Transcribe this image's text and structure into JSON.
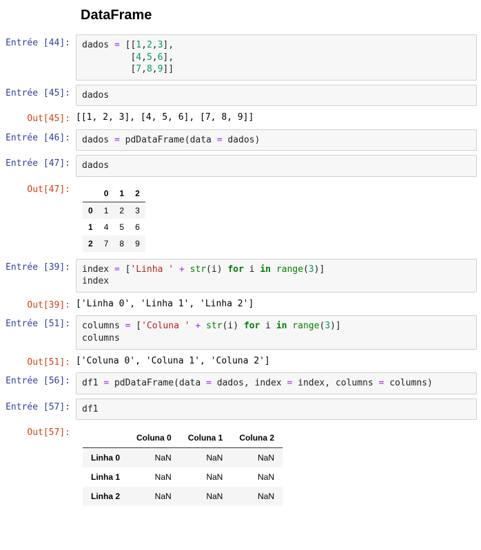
{
  "title": "DataFrame",
  "cells": {
    "c44": {
      "in_label": "Entrée [44]:"
    },
    "c45": {
      "in_label": "Entrée [45]:",
      "out_label": "Out[45]:",
      "out_text": "[[1, 2, 3], [4, 5, 6], [7, 8, 9]]"
    },
    "c46": {
      "in_label": "Entrée [46]:"
    },
    "c47": {
      "in_label": "Entrée [47]:",
      "out_label": "Out[47]:"
    },
    "c39": {
      "in_label": "Entrée [39]:",
      "out_label": "Out[39]:",
      "out_text": "['Linha 0', 'Linha 1', 'Linha 2']"
    },
    "c51": {
      "in_label": "Entrée [51]:",
      "out_label": "Out[51]:",
      "out_text": "['Coluna 0', 'Coluna 1', 'Coluna 2']"
    },
    "c56": {
      "in_label": "Entrée [56]:"
    },
    "c57": {
      "in_label": "Entrée [57]:",
      "out_label": "Out[57]:"
    }
  },
  "code": {
    "c44": {
      "plain": "dados = [[1,2,3],\n         [4,5,6],\n         [7,8,9]]",
      "t": {
        "dados": "dados",
        "eq": "=",
        "o1": "[[",
        "n1": "1",
        "c": ",",
        "n2": "2",
        "n3": "3",
        "cb": "],",
        "sp": "         ",
        "ob": "[",
        "n4": "4",
        "n5": "5",
        "n6": "6",
        "n7": "7",
        "n8": "8",
        "n9": "9",
        "cc": "]]"
      }
    },
    "c45": {
      "t": {
        "dados": "dados"
      }
    },
    "c46": {
      "plain": "dados = pd.DataFrame(data = dados)",
      "t": {
        "dados": "dados",
        "eq": "=",
        "pd": "pd",
        ".": ".",
        "DF": "DataFrame",
        "op": "(",
        "data": "data",
        "eq2": "=",
        "dados2": "dados",
        "cp": ")"
      }
    },
    "c47": {
      "t": {
        "dados": "dados"
      }
    },
    "c39": {
      "plain": "index = ['Linha ' + str(i) for i in range(3)]\nindex",
      "t": {
        "index": "index",
        "eq": "=",
        "ob": "[",
        "s": "'Linha '",
        "plus": "+",
        "str": "str",
        "op": "(",
        "i": "i",
        "cp": ")",
        "for": "for",
        "i2": "i",
        "in": "in",
        "range": "range",
        "op2": "(",
        "n3": "3",
        "cp2": ")",
        "cb": "]",
        "index2": "index"
      }
    },
    "c51": {
      "plain": "columns = ['Coluna ' + str(i) for i in range(3)]\ncolumns",
      "t": {
        "columns": "columns",
        "eq": "=",
        "ob": "[",
        "s": "'Coluna '",
        "plus": "+",
        "str": "str",
        "op": "(",
        "i": "i",
        "cp": ")",
        "for": "for",
        "i2": "i",
        "in": "in",
        "range": "range",
        "op2": "(",
        "n3": "3",
        "cp2": ")",
        "cb": "]",
        "columns2": "columns"
      }
    },
    "c56": {
      "plain": "df1 = pd.DataFrame(data = dados, index = index, columns = columns)",
      "t": {
        "df1": "df1",
        "eq": "=",
        "pd": "pd",
        ".": ".",
        "DF": "DataFrame",
        "op": "(",
        "data": "data",
        "eq2": "=",
        "dados": "dados",
        "c": ",",
        "index": "index",
        "eq3": "=",
        "index2": "index",
        "c2": ",",
        "columns": "columns",
        "eq4": "=",
        "columns2": "columns",
        "cp": ")"
      }
    },
    "c57": {
      "t": {
        "df1": "df1"
      }
    }
  },
  "tables": {
    "small": {
      "cols": [
        "0",
        "1",
        "2"
      ],
      "rows": [
        {
          "h": "0",
          "v": [
            "1",
            "2",
            "3"
          ]
        },
        {
          "h": "1",
          "v": [
            "4",
            "5",
            "6"
          ]
        },
        {
          "h": "2",
          "v": [
            "7",
            "8",
            "9"
          ]
        }
      ]
    },
    "big": {
      "cols": [
        "Coluna 0",
        "Coluna 1",
        "Coluna 2"
      ],
      "rows": [
        {
          "h": "Linha 0",
          "v": [
            "NaN",
            "NaN",
            "NaN"
          ]
        },
        {
          "h": "Linha 1",
          "v": [
            "NaN",
            "NaN",
            "NaN"
          ]
        },
        {
          "h": "Linha 2",
          "v": [
            "NaN",
            "NaN",
            "NaN"
          ]
        }
      ]
    }
  }
}
